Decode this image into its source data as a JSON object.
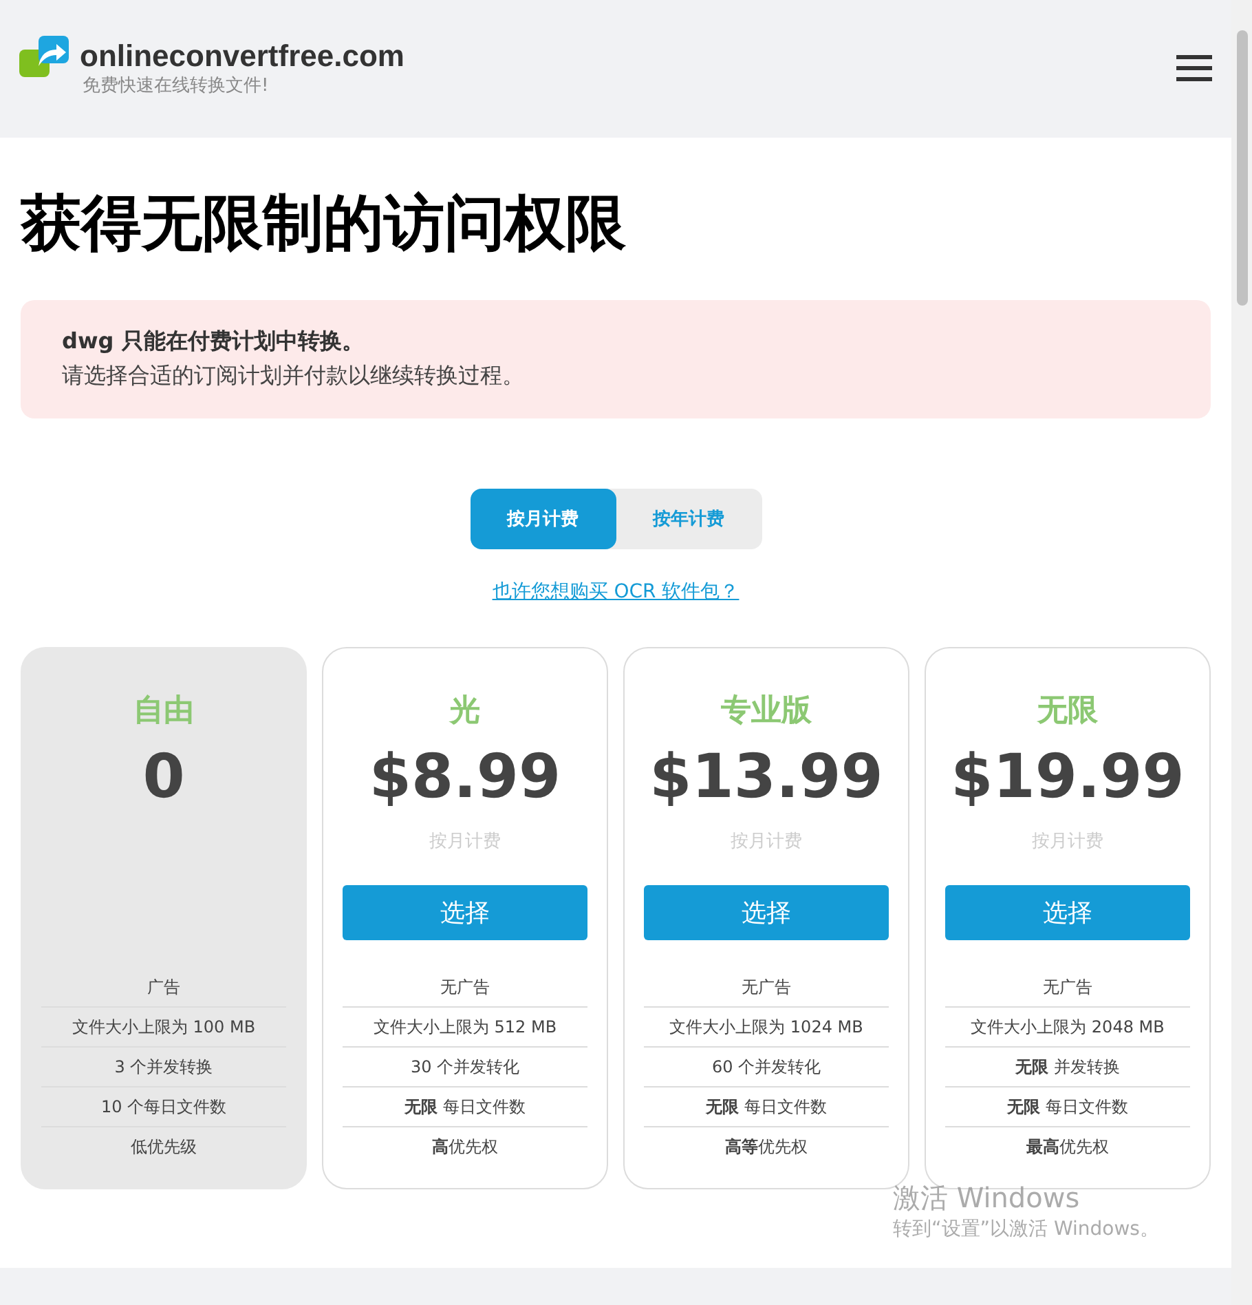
{
  "header": {
    "site_name": "onlineconvertfree.com",
    "tagline": "免费快速在线转换文件!"
  },
  "title": "获得无限制的访问权限",
  "alert": {
    "text": "dwg 只能在付费计划中转换。",
    "subtext": "请选择合适的订阅计划并付款以继续转换过程。"
  },
  "billing_tabs": [
    {
      "label": "按月计费",
      "selected": true
    },
    {
      "label": "按年计费",
      "selected": false
    }
  ],
  "ocr_link": "也许您想购买 OCR 软件包？",
  "plans": [
    {
      "name": "自由",
      "price": "0",
      "featured": false,
      "features": [
        "广告",
        "文件大小上限为 100 MB",
        "3 个并发转换",
        "10 个每日文件数",
        "低优先级"
      ]
    },
    {
      "name": "光",
      "price": "$8.99",
      "featured": true,
      "period": "按月计费",
      "button": "选择",
      "features": [
        "无广告",
        "文件大小上限为 512 MB",
        "30 个并发转化",
        "**无限** 每日文件数",
        "**高**优先权"
      ]
    },
    {
      "name": "专业版",
      "price": "$13.99",
      "featured": true,
      "period": "按月计费",
      "button": "选择",
      "features": [
        "无广告",
        "文件大小上限为 1024 MB",
        "60 个并发转化",
        "**无限** 每日文件数",
        "**高等**优先权"
      ]
    },
    {
      "name": "无限",
      "price": "$19.99",
      "featured": true,
      "period": "按月计费",
      "button": "选择",
      "features": [
        "无广告",
        "文件大小上限为 2048 MB",
        "**无限** 并发转换",
        "**无限** 每日文件数",
        "**最高**优先权"
      ]
    }
  ],
  "os_notice": {
    "title": "激活 Windows",
    "text": "转到“设置”以激活 Windows。"
  }
}
